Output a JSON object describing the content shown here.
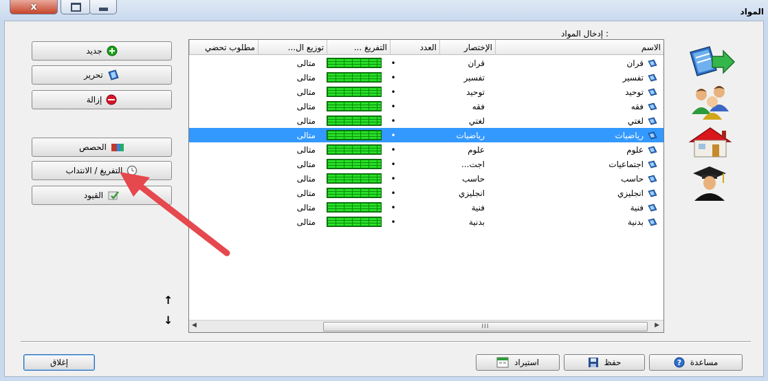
{
  "window": {
    "title": "المواد",
    "close_glyph": "x"
  },
  "section_label": "إدخال المواد :",
  "left_buttons": [
    {
      "label": "جديد",
      "icon": "add-icon",
      "color": "#1ca11c"
    },
    {
      "label": "تحرير",
      "icon": "edit-icon",
      "color": "#2b6fc9"
    },
    {
      "label": "إزالة",
      "icon": "remove-icon",
      "color": "#d9152a"
    },
    {
      "label": "الحصص",
      "icon": "lessons-icon",
      "color": "#c0392b"
    },
    {
      "label": "التفريغ / الانتداب",
      "icon": "clock-icon",
      "color": "#777777"
    },
    {
      "label": "القيود",
      "icon": "constraints-icon",
      "color": "#3a9a3a"
    }
  ],
  "grid": {
    "columns": [
      "الاسم",
      "الإختصار",
      "العدد",
      "التفريغ ...",
      "توزيع ال...",
      "مطلوب تحضي"
    ],
    "rows": [
      {
        "name": "قران",
        "abbr": "قران",
        "num": "•",
        "dist": "متالى"
      },
      {
        "name": "تفسير",
        "abbr": "تفسير",
        "num": "•",
        "dist": "متالى"
      },
      {
        "name": "توحيد",
        "abbr": "توحيد",
        "num": "•",
        "dist": "متالى"
      },
      {
        "name": "فقه",
        "abbr": "فقه",
        "num": "•",
        "dist": "متالى"
      },
      {
        "name": "لغتي",
        "abbr": "لغتي",
        "num": "•",
        "dist": "متالى"
      },
      {
        "name": "رياضيات",
        "abbr": "رياضيات",
        "num": "•",
        "dist": "متالى"
      },
      {
        "name": "علوم",
        "abbr": "علوم",
        "num": "•",
        "dist": "متالى"
      },
      {
        "name": "اجتماعيات",
        "abbr": "اجت...",
        "num": "•",
        "dist": "متالى"
      },
      {
        "name": "حاسب",
        "abbr": "حاسب",
        "num": "•",
        "dist": "متالى"
      },
      {
        "name": "انجليزي",
        "abbr": "انجليزي",
        "num": "•",
        "dist": "متالى"
      },
      {
        "name": "فنية",
        "abbr": "فنية",
        "num": "•",
        "dist": "متالى"
      },
      {
        "name": "بدنية",
        "abbr": "بدنية",
        "num": "•",
        "dist": "متالى"
      }
    ],
    "selected_row": 5,
    "scroll_label": "III"
  },
  "order_arrows": {
    "up": "↑",
    "down": "↓"
  },
  "bottom_buttons": {
    "close": "إغلاق",
    "import": "استيراد",
    "save": "حفظ",
    "help": "مساعدة"
  },
  "colors": {
    "selection": "#3399ff",
    "progress": "#28e028",
    "annotation_arrow": "#e5484d"
  }
}
